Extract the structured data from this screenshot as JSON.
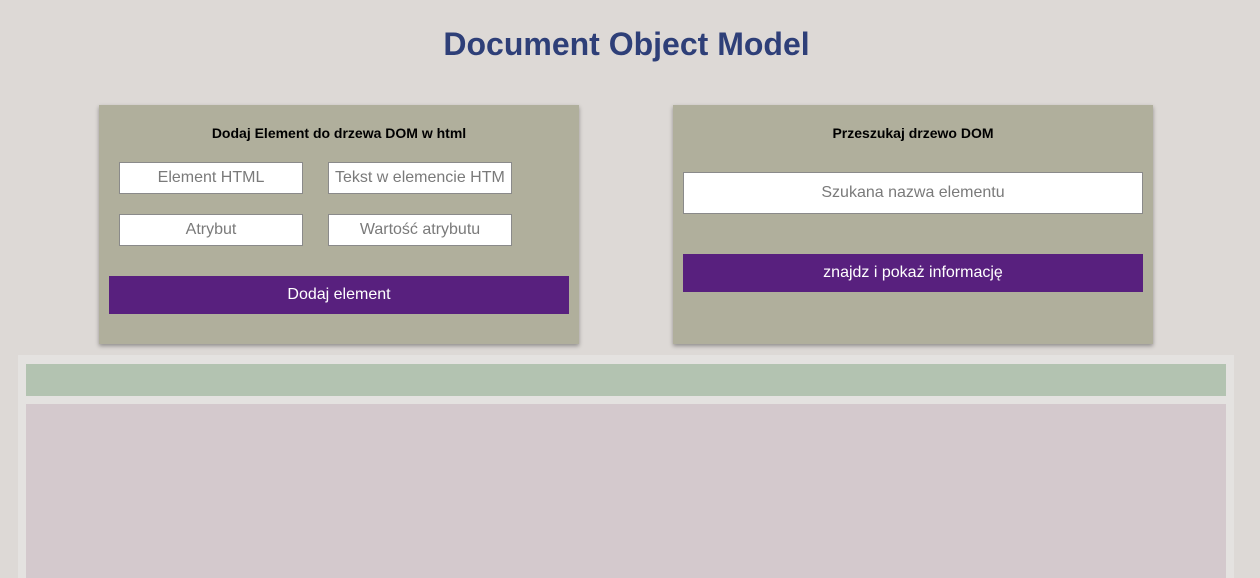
{
  "page": {
    "title": "Document Object Model"
  },
  "add_panel": {
    "heading": "Dodaj Element do drzewa DOM w html",
    "element_placeholder": "Element HTML",
    "text_placeholder": "Tekst w elemencie HTML",
    "attribute_placeholder": "Atrybut",
    "attribute_value_placeholder": "Wartość atrybutu",
    "button_label": "Dodaj element"
  },
  "search_panel": {
    "heading": "Przeszukaj drzewo DOM",
    "search_placeholder": "Szukana nazwa elementu",
    "button_label": "znajdz i pokaż informację"
  },
  "colors": {
    "background": "#ddd9d6",
    "title": "#2e3f78",
    "panel": "#b0af9c",
    "button": "#58207e",
    "info_strip": "#b3c3b1",
    "dom_container": "#d4c9cd"
  }
}
